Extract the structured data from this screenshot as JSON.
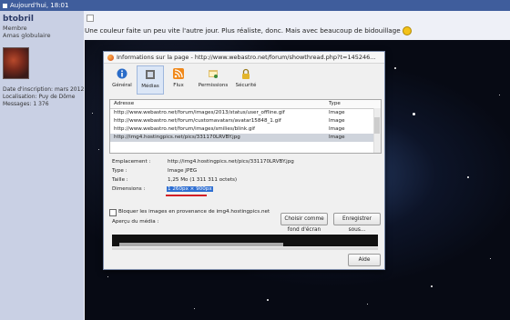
{
  "forum": {
    "top_bar_text": "Aujourd'hui, 18:01",
    "user": {
      "name": "btobril",
      "role": "Membre",
      "rank": "Amas globulaire",
      "signup": "Date d'inscription: mars 2012",
      "location": "Localisation: Puy de Dôme",
      "messages": "Messages: 1 376"
    },
    "post_text": "Une couleur faite un peu vite l'autre jour. Plus réaliste, donc. Mais avec beaucoup de bidouillage"
  },
  "dialog": {
    "title": "Informations sur la page - http://www.webastro.net/forum/showthread.php?t=145246...",
    "tabs": [
      {
        "label": "Général",
        "icon": "info-icon"
      },
      {
        "label": "Médias",
        "icon": "media-icon",
        "selected": true
      },
      {
        "label": "Flux",
        "icon": "rss-icon"
      },
      {
        "label": "Permissions",
        "icon": "permissions-icon"
      },
      {
        "label": "Sécurité",
        "icon": "lock-icon"
      }
    ],
    "list": {
      "col_address": "Adresse",
      "col_type": "Type",
      "rows": [
        {
          "address": "http://www.webastro.net/forum/images/2013/status/user_offline.gif",
          "type": "Image"
        },
        {
          "address": "http://www.webastro.net/forum/customavatars/avatar15848_1.gif",
          "type": "Image"
        },
        {
          "address": "http://www.webastro.net/forum/images/smilies/blink.gif",
          "type": "Image"
        },
        {
          "address": "http://img4.hostingpics.net/pics/331170LRVBY.jpg",
          "type": "Image",
          "selected": true
        }
      ]
    },
    "props": {
      "location_label": "Emplacement :",
      "location_value": "http://img4.hostingpics.net/pics/331170LRVBY.jpg",
      "type_label": "Type :",
      "type_value": "Image JPEG",
      "size_label": "Taille :",
      "size_value": "1,25 Mo (1 311 311 octets)",
      "dim_label": "Dimensions :",
      "dim_value": "1 260px × 900px"
    },
    "block_label": "Bloquer les images en provenance de img4.hostingpics.net",
    "save_as": "Enregistrer sous...",
    "set_background": "Choisir comme fond d'écran",
    "preview_label": "Aperçu du média :",
    "help": "Aide"
  },
  "colors": {
    "top_bar": "#3f5d9c",
    "selection": "#2f6fd2",
    "underline": "#d21f26"
  }
}
